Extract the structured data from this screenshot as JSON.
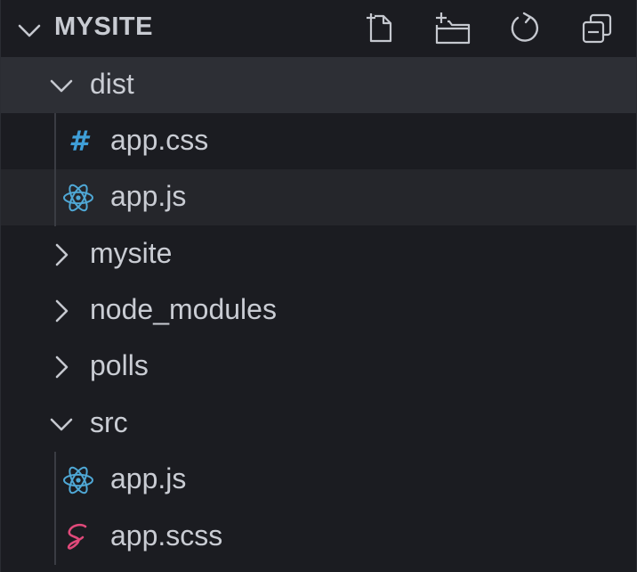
{
  "explorer": {
    "title": "MYSITE",
    "actions": [
      {
        "name": "new-file",
        "icon": "new-file-icon"
      },
      {
        "name": "new-folder",
        "icon": "new-folder-icon"
      },
      {
        "name": "refresh",
        "icon": "refresh-icon"
      },
      {
        "name": "collapse-all",
        "icon": "collapse-all-icon"
      }
    ]
  },
  "tree": {
    "dist": {
      "label": "dist",
      "expanded": true
    },
    "dist_css": {
      "label": "app.css",
      "icon": "css-hash-icon"
    },
    "dist_js": {
      "label": "app.js",
      "icon": "react-icon"
    },
    "mysite": {
      "label": "mysite",
      "expanded": false
    },
    "node_modules": {
      "label": "node_modules",
      "expanded": false
    },
    "polls": {
      "label": "polls",
      "expanded": false
    },
    "src": {
      "label": "src",
      "expanded": true
    },
    "src_js": {
      "label": "app.js",
      "icon": "react-icon"
    },
    "src_scss": {
      "label": "app.scss",
      "icon": "sass-icon"
    }
  },
  "colors": {
    "background": "#1b1c21",
    "selected_row": "#2d2f35",
    "hover_row": "#25262b",
    "text": "#c9ccd3",
    "css_icon": "#3f9fd8",
    "react_icon": "#4fa8d6",
    "sass_icon": "#e0497a"
  }
}
